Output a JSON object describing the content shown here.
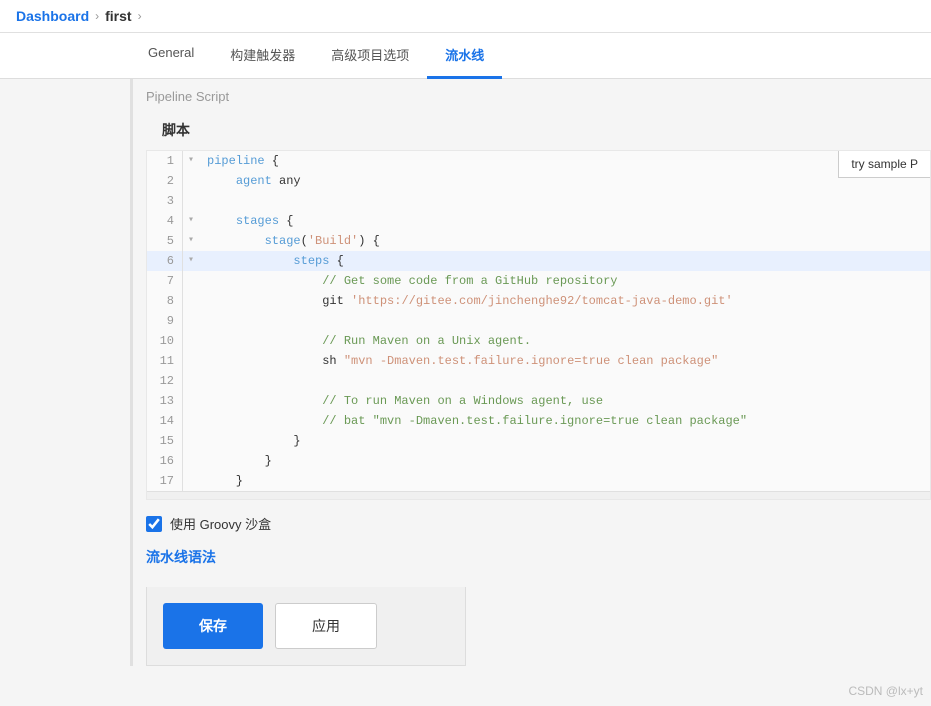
{
  "breadcrumb": {
    "dashboard": "Dashboard",
    "sep1": "›",
    "project": "first",
    "sep2": "›"
  },
  "tabs": [
    {
      "id": "general",
      "label": "General"
    },
    {
      "id": "triggers",
      "label": "构建触发器"
    },
    {
      "id": "advanced",
      "label": "高级项目选项"
    },
    {
      "id": "pipeline",
      "label": "流水线",
      "active": true
    }
  ],
  "pipeline": {
    "section_label": "Pipeline Script",
    "script_title": "脚本",
    "try_sample_label": "try sample P",
    "code_lines": [
      {
        "num": 1,
        "fold": "▾",
        "content": "pipeline {",
        "highlight": false
      },
      {
        "num": 2,
        "fold": "",
        "content": "    agent any",
        "highlight": false
      },
      {
        "num": 3,
        "fold": "",
        "content": "",
        "highlight": false
      },
      {
        "num": 4,
        "fold": "▾",
        "content": "    stages {",
        "highlight": false
      },
      {
        "num": 5,
        "fold": "▾",
        "content": "        stage('Build') {",
        "highlight": false
      },
      {
        "num": 6,
        "fold": "▾",
        "content": "            steps {",
        "highlight": true
      },
      {
        "num": 7,
        "fold": "",
        "content": "                // Get some code from a GitHub repository",
        "highlight": false
      },
      {
        "num": 8,
        "fold": "",
        "content": "                git 'https://gitee.com/jinchenghe92/tomcat-java-demo.git'",
        "highlight": false
      },
      {
        "num": 9,
        "fold": "",
        "content": "",
        "highlight": false
      },
      {
        "num": 10,
        "fold": "",
        "content": "                // Run Maven on a Unix agent.",
        "highlight": false
      },
      {
        "num": 11,
        "fold": "",
        "content": "                sh \"mvn -Dmaven.test.failure.ignore=true clean package\"",
        "highlight": false
      },
      {
        "num": 12,
        "fold": "",
        "content": "",
        "highlight": false
      },
      {
        "num": 13,
        "fold": "",
        "content": "                // To run Maven on a Windows agent, use",
        "highlight": false
      },
      {
        "num": 14,
        "fold": "",
        "content": "                // bat \"mvn -Dmaven.test.failure.ignore=true clean package\"",
        "highlight": false
      },
      {
        "num": 15,
        "fold": "",
        "content": "            }",
        "highlight": false
      },
      {
        "num": 16,
        "fold": "",
        "content": "        }",
        "highlight": false
      },
      {
        "num": 17,
        "fold": "",
        "content": "    }",
        "highlight": false
      }
    ],
    "groovy_sandbox_label": "使用 Groovy 沙盒",
    "groovy_checked": true,
    "pipeline_syntax_label": "流水线语法"
  },
  "buttons": {
    "save": "保存",
    "apply": "应用"
  },
  "watermark": "CSDN @lx+yt"
}
